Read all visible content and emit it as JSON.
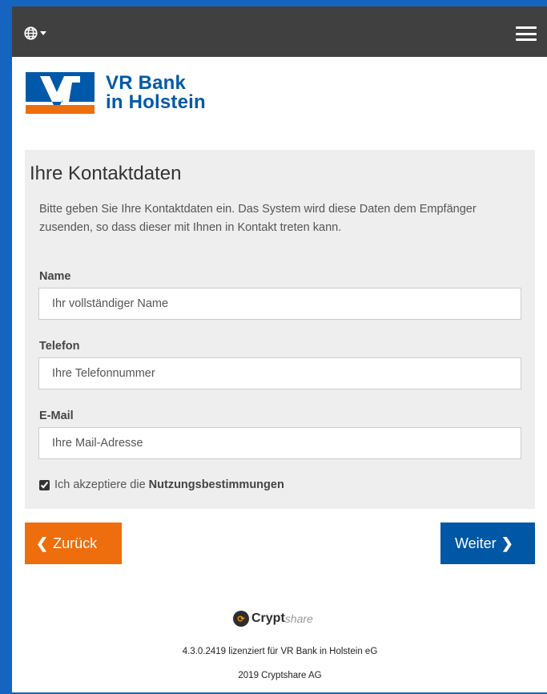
{
  "header": {
    "language_icon": "globe-icon",
    "menu_icon": "hamburger-menu-icon"
  },
  "brand": {
    "name_line1": "VR Bank",
    "name_line2": "in Holstein",
    "colors": {
      "blue": "#0059a8",
      "orange": "#ee6d0c"
    }
  },
  "form": {
    "title": "Ihre Kontaktdaten",
    "intro": "Bitte geben Sie Ihre Kontaktdaten ein. Das System wird diese Daten dem Empfänger zusenden, so dass dieser mit Ihnen in Kontakt treten kann.",
    "name": {
      "label": "Name",
      "value": "",
      "placeholder": "Ihr vollständiger Name"
    },
    "phone": {
      "label": "Telefon",
      "value": "",
      "placeholder": "Ihre Telefonnummer"
    },
    "email": {
      "label": "E-Mail",
      "value": "",
      "placeholder": "Ihre Mail-Adresse"
    },
    "terms": {
      "prefix": "Ich akzeptiere die",
      "link": "Nutzungsbestimmungen",
      "checked": true
    }
  },
  "actions": {
    "back_label": "Zurück",
    "back_icon": "chevron-left-icon",
    "next_label": "Weiter",
    "next_icon": "chevron-right-icon"
  },
  "footer": {
    "logo_bold": "Crypt",
    "logo_italic": "share",
    "license": "4.3.0.2419 lizenziert für VR Bank in Holstein eG",
    "copyright": "2019 Cryptshare AG"
  }
}
